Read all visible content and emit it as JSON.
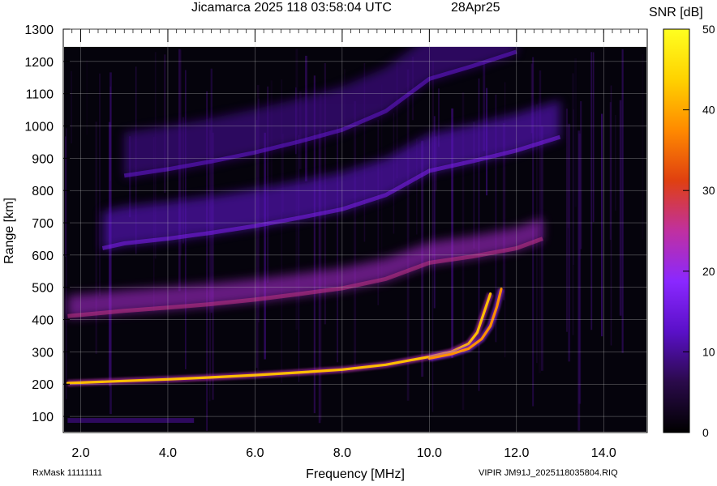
{
  "header": {
    "title": "Jicamarca 2025 118 03:58:04 UTC",
    "date": "28Apr25"
  },
  "footer": {
    "rxmask": "RxMask 11111111",
    "file": "VIPIR  JM91J_2025118035804.RIQ"
  },
  "colorbar": {
    "label": "SNR [dB]",
    "min": 0,
    "max": 50,
    "ticks": [
      "0",
      "10",
      "20",
      "30",
      "40",
      "50"
    ],
    "stops": [
      "#000000",
      "#2a0a4a",
      "#5a10c8",
      "#8a28ff",
      "#c030a0",
      "#e04010",
      "#ff8a00",
      "#ffd200",
      "#ffff20"
    ]
  },
  "chart_data": {
    "type": "heatmap",
    "xlabel": "Frequency [MHz]",
    "ylabel": "Range [km]",
    "xlim": [
      1.6,
      15.0
    ],
    "ylim": [
      50,
      1300
    ],
    "xticks": [
      "2.0",
      "4.0",
      "6.0",
      "8.0",
      "10.0",
      "12.0",
      "14.0"
    ],
    "yticks": [
      "100",
      "200",
      "300",
      "400",
      "500",
      "600",
      "700",
      "800",
      "900",
      "1000",
      "1100",
      "1200",
      "1300"
    ],
    "data_top_km": 1245,
    "traces": [
      {
        "id": "f-layer-ordinary",
        "snr_db": 42,
        "points": [
          [
            1.7,
            203
          ],
          [
            3.0,
            210
          ],
          [
            4.0,
            215
          ],
          [
            5.0,
            221
          ],
          [
            6.0,
            228
          ],
          [
            7.0,
            236
          ],
          [
            8.0,
            245
          ],
          [
            9.0,
            260
          ],
          [
            10.0,
            285
          ],
          [
            10.5,
            300
          ],
          [
            10.9,
            325
          ],
          [
            11.1,
            360
          ],
          [
            11.25,
            420
          ],
          [
            11.4,
            480
          ]
        ]
      },
      {
        "id": "f-layer-extraordinary",
        "snr_db": 38,
        "points": [
          [
            10.0,
            280
          ],
          [
            10.5,
            293
          ],
          [
            10.9,
            310
          ],
          [
            11.2,
            340
          ],
          [
            11.4,
            380
          ],
          [
            11.55,
            440
          ],
          [
            11.65,
            495
          ]
        ]
      },
      {
        "id": "multihop-2",
        "snr_db": 22,
        "band_km": 70,
        "points": [
          [
            1.7,
            405
          ],
          [
            3.0,
            421
          ],
          [
            4.0,
            431
          ],
          [
            5.0,
            442
          ],
          [
            6.0,
            456
          ],
          [
            7.0,
            473
          ],
          [
            8.0,
            491
          ],
          [
            9.0,
            520
          ],
          [
            10.0,
            570
          ],
          [
            11.0,
            590
          ],
          [
            12.0,
            615
          ],
          [
            12.6,
            645
          ]
        ]
      },
      {
        "id": "multihop-3",
        "snr_db": 13,
        "band_km": 120,
        "points": [
          [
            2.5,
            615
          ],
          [
            3.0,
            630
          ],
          [
            4.0,
            645
          ],
          [
            5.0,
            663
          ],
          [
            6.0,
            684
          ],
          [
            7.0,
            709
          ],
          [
            8.0,
            736
          ],
          [
            9.0,
            780
          ],
          [
            10.0,
            855
          ],
          [
            11.0,
            885
          ],
          [
            12.0,
            918
          ],
          [
            13.0,
            960
          ]
        ]
      },
      {
        "id": "multihop-4",
        "snr_db": 10,
        "band_km": 140,
        "points": [
          [
            3.0,
            840
          ],
          [
            4.0,
            860
          ],
          [
            5.0,
            884
          ],
          [
            6.0,
            912
          ],
          [
            7.0,
            945
          ],
          [
            8.0,
            982
          ],
          [
            9.0,
            1040
          ],
          [
            10.0,
            1140
          ],
          [
            11.0,
            1180
          ],
          [
            12.0,
            1224
          ]
        ]
      }
    ]
  }
}
